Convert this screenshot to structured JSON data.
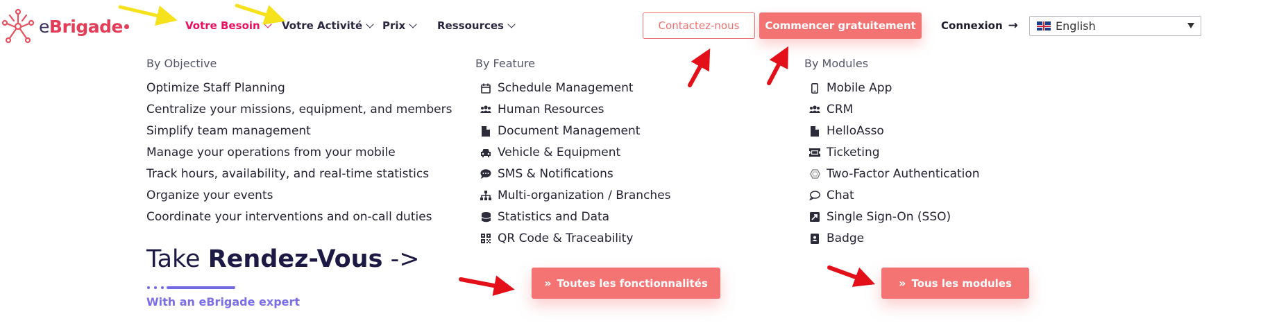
{
  "header": {
    "logo_text_pre": "e",
    "logo_text_brand": "Brigade",
    "nav": [
      {
        "label": "Votre Besoin"
      },
      {
        "label": "Votre Activité"
      },
      {
        "label": "Prix"
      },
      {
        "label": "Ressources"
      }
    ],
    "contact_label": "Contactez-nous",
    "start_label": "Commencer gratuitement",
    "login_label": "Connexion",
    "login_arrow": "→",
    "language": "English"
  },
  "menu": {
    "objective": {
      "title": "By Objective",
      "items": [
        "Optimize Staff Planning",
        "Centralize your missions, equipment, and members",
        "Simplify team management",
        "Manage your operations from your mobile",
        "Track hours, availability, and real-time statistics",
        "Organize your events",
        "Coordinate your interventions and on-call duties"
      ]
    },
    "feature": {
      "title": "By Feature",
      "items": [
        {
          "label": "Schedule Management",
          "icon": "calendar-icon"
        },
        {
          "label": "Human Resources",
          "icon": "users-icon"
        },
        {
          "label": "Document Management",
          "icon": "file-icon"
        },
        {
          "label": "Vehicle & Equipment",
          "icon": "car-icon"
        },
        {
          "label": "SMS & Notifications",
          "icon": "sms-icon"
        },
        {
          "label": "Multi-organization / Branches",
          "icon": "sitemap-icon"
        },
        {
          "label": "Statistics and Data",
          "icon": "database-icon"
        },
        {
          "label": "QR Code & Traceability",
          "icon": "qrcode-icon"
        }
      ],
      "cta_label": "Toutes les fonctionnalités"
    },
    "modules": {
      "title": "By Modules",
      "items": [
        {
          "label": "Mobile App",
          "icon": "mobile-icon"
        },
        {
          "label": "CRM",
          "icon": "users-icon"
        },
        {
          "label": "HelloAsso",
          "icon": "file-icon"
        },
        {
          "label": "Ticketing",
          "icon": "ticket-icon"
        },
        {
          "label": "Two-Factor Authentication",
          "icon": "hexagon-icon"
        },
        {
          "label": "Chat",
          "icon": "chat-icon"
        },
        {
          "label": "Single Sign-On (SSO)",
          "icon": "sso-icon"
        },
        {
          "label": "Badge",
          "icon": "badge-icon"
        }
      ],
      "cta_label": "Tous les modules"
    },
    "rdv": {
      "take": "Take ",
      "strong": "Rendez-Vous",
      "arrow": " ->",
      "expert": "With an eBrigade expert"
    },
    "cta_chevrons": "»"
  },
  "colors": {
    "accent": "#f37373",
    "active_nav": "#e8105f",
    "expert": "#7c6fe6",
    "annotation_yellow": "#f6e21c",
    "annotation_red": "#e3101a"
  }
}
